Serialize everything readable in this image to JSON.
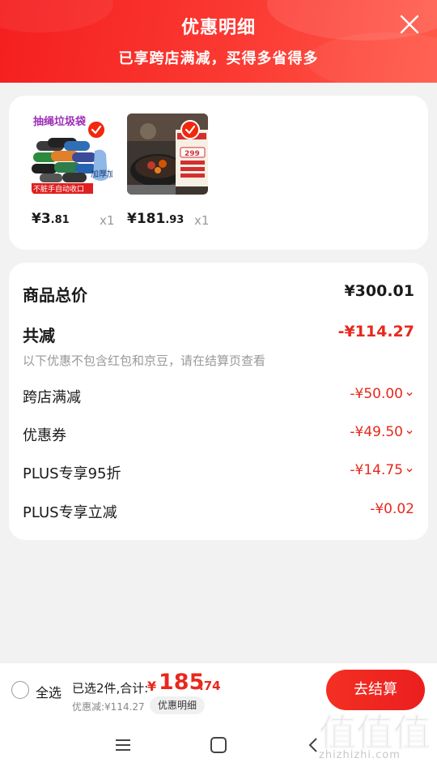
{
  "header": {
    "title": "优惠明细",
    "subtitle": "已享跨店满减，买得多省得多",
    "close_icon": "close-icon"
  },
  "products": [
    {
      "thumb_caption_top": "抽绳垃圾袋",
      "thumb_caption_side": "加厚加大",
      "thumb_caption_bottom": "不脏手自动收口",
      "price_int": "¥3",
      "price_dec": ".81",
      "qty": "x1"
    },
    {
      "thumb_price_tag": "299",
      "price_int": "¥181",
      "price_dec": ".93",
      "qty": "x1"
    }
  ],
  "summary": {
    "total_label": "商品总价",
    "total_value": "¥300.01",
    "reduce_label": "共减",
    "reduce_value": "-¥114.27",
    "note": "以下优惠不包含红包和京豆，请在结算页查看",
    "items": [
      {
        "label": "跨店满减",
        "value": "-¥50.00"
      },
      {
        "label": "优惠券",
        "value": "-¥49.50"
      },
      {
        "label": "PLUS专享95折",
        "value": "-¥14.75"
      },
      {
        "label": "PLUS专享立减",
        "value": "-¥0.02"
      }
    ]
  },
  "bottom_bar": {
    "select_all": "全选",
    "selected_text": "已选2件,合计:",
    "total_yen": "¥",
    "total_int": "185",
    "total_dec": ".74",
    "discount_text": "优惠减:¥114.27",
    "detail_button": "优惠明细",
    "checkout_button": "去结算"
  },
  "watermark": {
    "logo_text": "值",
    "site_text": "zhizhizhi.com"
  },
  "colors": {
    "brand_red": "#f2270c",
    "price_red": "#e8281d"
  }
}
